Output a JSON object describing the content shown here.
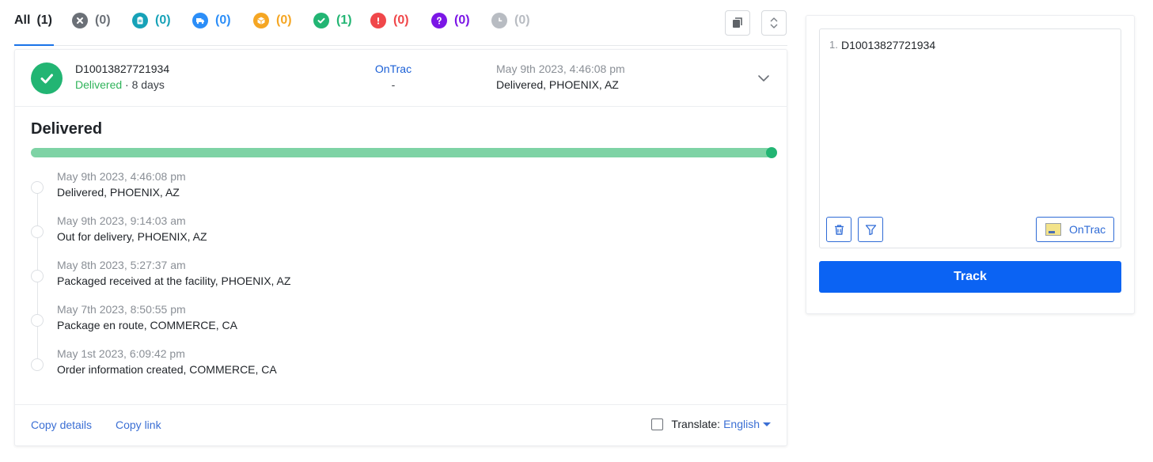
{
  "tabs": [
    {
      "name": "tab-all",
      "label": "All",
      "count": "(1)",
      "color": "#1f2328"
    },
    {
      "name": "tab-exception-cancelled",
      "icon": "x-circle-icon",
      "count": "(0)",
      "color": "#6b7077"
    },
    {
      "name": "tab-info-received",
      "icon": "clipboard-icon",
      "count": "(0)",
      "color": "#17a2b8"
    },
    {
      "name": "tab-in-transit",
      "icon": "truck-icon",
      "count": "(0)",
      "color": "#2c8ef8"
    },
    {
      "name": "tab-out-for-delivery",
      "icon": "box-icon",
      "count": "(0)",
      "color": "#f5a623"
    },
    {
      "name": "tab-delivered",
      "icon": "check-circle-icon",
      "count": "(1)",
      "color": "#22b573"
    },
    {
      "name": "tab-exception",
      "icon": "alert-icon",
      "count": "(0)",
      "color": "#f0474a"
    },
    {
      "name": "tab-unknown",
      "icon": "question-icon",
      "count": "(0)",
      "color": "#7b16e6"
    },
    {
      "name": "tab-expired",
      "icon": "clock-icon",
      "count": "(0)",
      "color": "#b8bcc2"
    }
  ],
  "shipment": {
    "tracking_number": "D10013827721934",
    "status": "Delivered",
    "duration": " · 8 days",
    "carrier": "OnTrac",
    "carrier_sub": "-",
    "latest_time": "May 9th 2023, 4:46:08 pm",
    "latest_location": "Delivered, PHOENIX, AZ",
    "detail_title": "Delivered",
    "progress_percent": 100,
    "events": [
      {
        "time": "May 9th 2023, 4:46:08 pm",
        "desc": "Delivered, PHOENIX, AZ"
      },
      {
        "time": "May 9th 2023, 9:14:03 am",
        "desc": "Out for delivery, PHOENIX, AZ"
      },
      {
        "time": "May 8th 2023, 5:27:37 am",
        "desc": "Packaged received at the facility, PHOENIX, AZ"
      },
      {
        "time": "May 7th 2023, 8:50:55 pm",
        "desc": "Package en route, COMMERCE, CA"
      },
      {
        "time": "May 1st 2023, 6:09:42 pm",
        "desc": "Order information created, COMMERCE, CA"
      }
    ]
  },
  "footer": {
    "copy_details": "Copy details",
    "copy_link": "Copy link",
    "translate_label": "Translate:",
    "language": "English"
  },
  "panel": {
    "line_number": "1.",
    "input_value": "D10013827721934",
    "carrier_button": "OnTrac",
    "track_button": "Track"
  },
  "colors": {
    "accent": "#0b63f3",
    "delivered": "#22b573",
    "link": "#3b6fd4"
  }
}
